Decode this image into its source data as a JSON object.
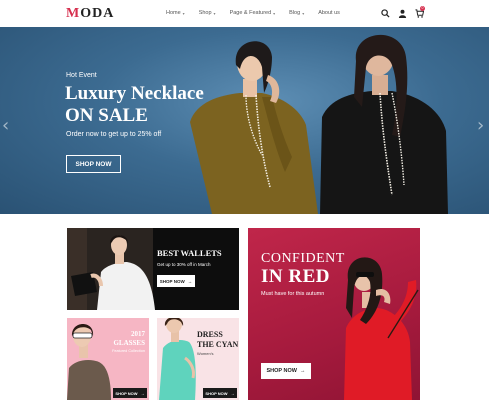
{
  "header": {
    "logo_prefix": "M",
    "logo_rest": "ODA",
    "nav": [
      {
        "label": "Home",
        "chevron": true
      },
      {
        "label": "Shop",
        "chevron": true
      },
      {
        "label": "Page & Featured",
        "chevron": true
      },
      {
        "label": "Blog",
        "chevron": true
      },
      {
        "label": "About us",
        "chevron": false
      }
    ],
    "icons": [
      "search-icon",
      "user-icon",
      "cart-icon"
    ],
    "cart_count": "0"
  },
  "hero": {
    "kicker": "Hot Event",
    "title_line1": "Luxury Necklace",
    "title_line2": "ON SALE",
    "subtitle": "Order now to get up to 25% off",
    "button": "SHOP NOW"
  },
  "tiles": {
    "wallets": {
      "title": "BEST WALLETS",
      "subtitle": "Get up to 30% off in March",
      "button": "SHOP NOW"
    },
    "red": {
      "title_line1": "CONFIDENT",
      "title_line2": "IN RED",
      "subtitle": "Must have for this autumn",
      "button": "SHOP NOW"
    },
    "glasses": {
      "title_line1": "2017",
      "title_line2": "GLASSES",
      "subtitle": "Featured Collection",
      "button": "SHOP NOW"
    },
    "cyan": {
      "title_line1": "DRESS",
      "title_line2": "THE CYAN",
      "subtitle": "Women's",
      "button": "SHOP NOW"
    }
  },
  "colors": {
    "brand": "#d62f4e",
    "hero_bg": "#3c6b91",
    "red_tile": "#b01f44",
    "glasses_tile": "#f6b6c4",
    "cyan_tile": "#f9e3e6"
  }
}
